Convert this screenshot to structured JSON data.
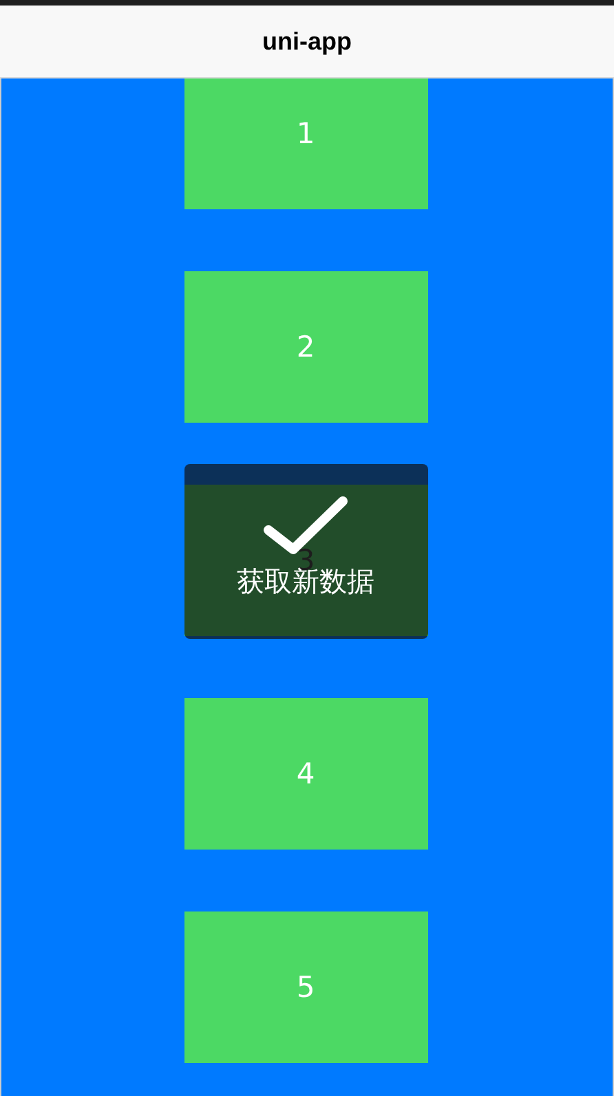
{
  "navbar": {
    "title": "uni-app"
  },
  "items": [
    {
      "label": "1"
    },
    {
      "label": "2"
    },
    {
      "label": "3",
      "toast": {
        "kind": "success",
        "text": "获取新数据"
      }
    },
    {
      "label": "4"
    },
    {
      "label": "5"
    }
  ]
}
